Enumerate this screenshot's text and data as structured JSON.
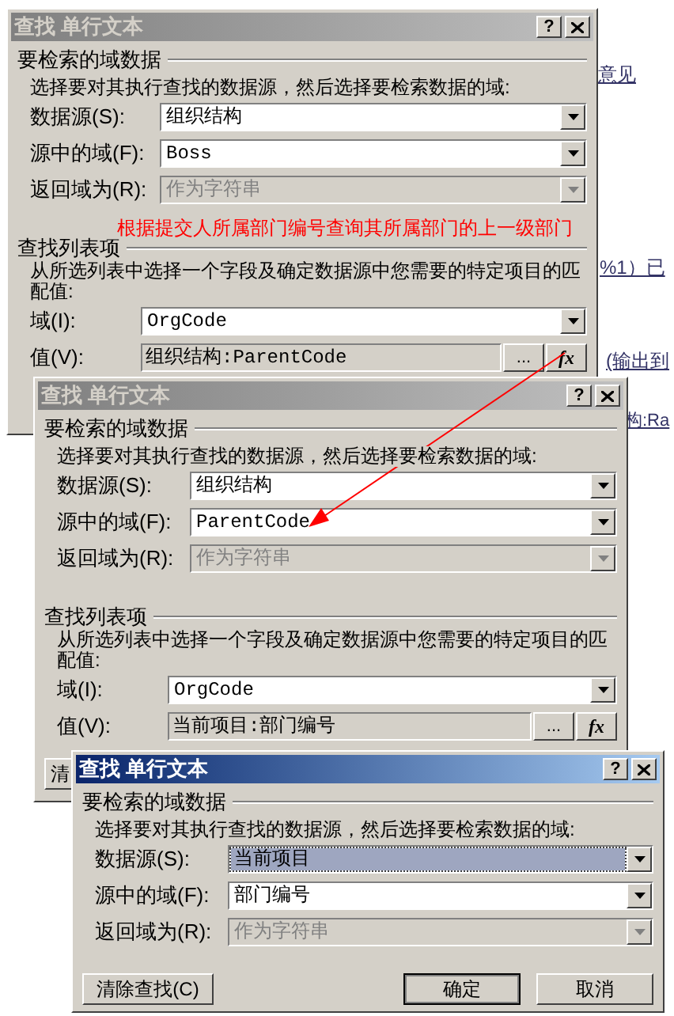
{
  "background_texts": [
    "意见",
    "%1）已",
    "(输出到",
    "构:Ra"
  ],
  "dialogs": [
    {
      "title": "查找 单行文本",
      "active": false,
      "help": "?",
      "annotation": "根据提交人所属部门编号查询其所属部门的上一级部门",
      "sections": [
        {
          "title": "要检索的域数据",
          "description": "选择要对其执行查找的数据源，然后选择要检索数据的域:",
          "fields": [
            {
              "kind": "combo",
              "label": "数据源(S):",
              "value": "组织结构",
              "disabled": false,
              "selected": false
            },
            {
              "kind": "combo",
              "label": "源中的域(F):",
              "value": "Boss",
              "disabled": false,
              "selected": false
            },
            {
              "kind": "combo",
              "label": "返回域为(R):",
              "value": "作为字符串",
              "disabled": true,
              "selected": false
            }
          ]
        },
        {
          "title": "查找列表项",
          "description": "从所选列表中选择一个字段及确定数据源中您需要的特定项目的匹配值:",
          "fields": [
            {
              "kind": "combo",
              "label": "域(I):",
              "value": "OrgCode",
              "disabled": false,
              "selected": false
            },
            {
              "kind": "value",
              "label": "值(V):",
              "value": "组织结构:ParentCode",
              "browse": "...",
              "formula": "fx"
            }
          ]
        }
      ]
    },
    {
      "title": "查找 单行文本",
      "active": false,
      "help": "?",
      "sections": [
        {
          "title": "要检索的域数据",
          "description": "选择要对其执行查找的数据源，然后选择要检索数据的域:",
          "fields": [
            {
              "kind": "combo",
              "label": "数据源(S):",
              "value": "组织结构",
              "disabled": false,
              "selected": false
            },
            {
              "kind": "combo",
              "label": "源中的域(F):",
              "value": "ParentCode",
              "disabled": false,
              "selected": false
            },
            {
              "kind": "combo",
              "label": "返回域为(R):",
              "value": "作为字符串",
              "disabled": true,
              "selected": false
            }
          ]
        },
        {
          "title": "查找列表项",
          "description": "从所选列表中选择一个字段及确定数据源中您需要的特定项目的匹配值:",
          "fields": [
            {
              "kind": "combo",
              "label": "域(I):",
              "value": "OrgCode",
              "disabled": false,
              "selected": false
            },
            {
              "kind": "value",
              "label": "值(V):",
              "value": "当前项目:部门编号",
              "browse": "...",
              "formula": "fx"
            }
          ]
        }
      ],
      "buttons": [
        {
          "label": "清",
          "default": false
        }
      ]
    },
    {
      "title": "查找 单行文本",
      "active": true,
      "help": "?",
      "sections": [
        {
          "title": "要检索的域数据",
          "description": "选择要对其执行查找的数据源，然后选择要检索数据的域:",
          "fields": [
            {
              "kind": "combo",
              "label": "数据源(S):",
              "value": "当前项目",
              "disabled": false,
              "selected": true
            },
            {
              "kind": "combo",
              "label": "源中的域(F):",
              "value": "部门编号",
              "disabled": false,
              "selected": false
            },
            {
              "kind": "combo",
              "label": "返回域为(R):",
              "value": "作为字符串",
              "disabled": true,
              "selected": false
            }
          ]
        }
      ],
      "buttons": [
        {
          "label": "清除查找(C)",
          "default": false
        },
        {
          "label": "确定",
          "default": true
        },
        {
          "label": "取消",
          "default": false
        }
      ]
    }
  ]
}
